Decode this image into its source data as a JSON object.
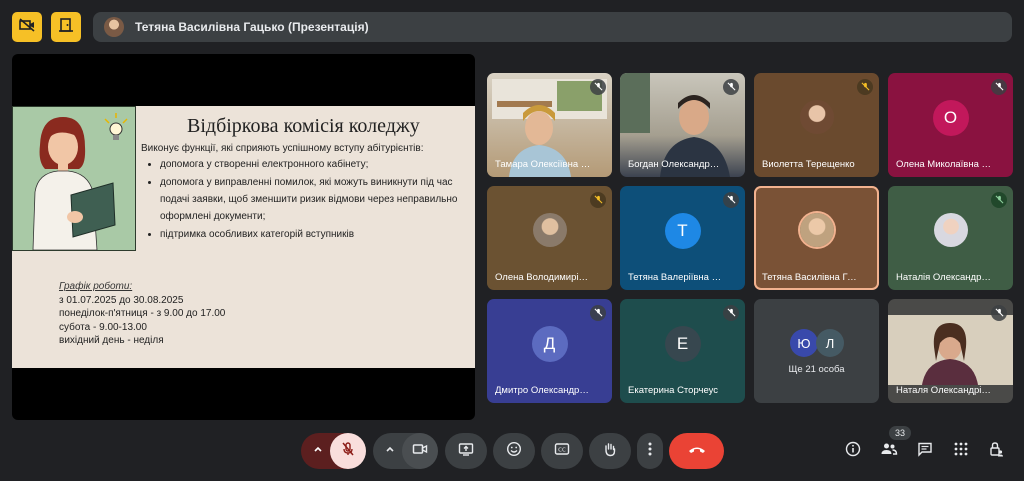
{
  "presenter": {
    "name": "Тетяна Василівна Гацько (Презентація)"
  },
  "slide": {
    "title": "Відбіркова комісія коледжу",
    "intro": "Виконує функції, які сприяють успішному вступу абітурієнтів:",
    "bullets": [
      "допомога у створенні електронного кабінету;",
      "допомога у виправленні помилок, які можуть виникнути під час подачі заявки, щоб зменшити ризик відмови через неправильно оформлені документи;",
      "підтримка особливих категорій вступників"
    ],
    "schedule_label": "Графік роботи:",
    "schedule": [
      "з 01.07.2025 до 30.08.2025",
      "понеділок-п'ятниця -  з 9.00 до 17.00",
      "субота - 9.00-13.00",
      "вихідний день - неділя"
    ]
  },
  "participants": [
    {
      "name": "Тамара Олексіївна К...",
      "type": "video"
    },
    {
      "name": "Богдан Олександров...",
      "type": "video"
    },
    {
      "name": "Виолетта Терещенко",
      "type": "photo"
    },
    {
      "name": "Олена Миколаївна К...",
      "type": "letter",
      "letter": "О",
      "color": "#c2185b"
    },
    {
      "name": "Олена Володимирівн...",
      "type": "photo"
    },
    {
      "name": "Тетяна Валеріївна Ко...",
      "type": "letter",
      "letter": "Т",
      "color": "#1e88e5"
    },
    {
      "name": "Тетяна Василівна Гац...",
      "type": "photo"
    },
    {
      "name": "Наталія Олександрів...",
      "type": "photo"
    },
    {
      "name": "Дмитро Олександро...",
      "type": "letter",
      "letter": "Д",
      "color": "#5c6bc0"
    },
    {
      "name": "Екатерина Сторчеус",
      "type": "letter",
      "letter": "Е",
      "color": "#37474f"
    },
    {
      "name": "Ще 21 особа",
      "type": "more",
      "letters": [
        "Ю",
        "Л"
      ]
    },
    {
      "name": "Наталя Олександрів...",
      "type": "video"
    }
  ],
  "people_count": "33",
  "colors": {
    "accent_yellow": "#f6c026",
    "end_call_red": "#ea4335",
    "mic_off_bg": "#f9dedc"
  }
}
